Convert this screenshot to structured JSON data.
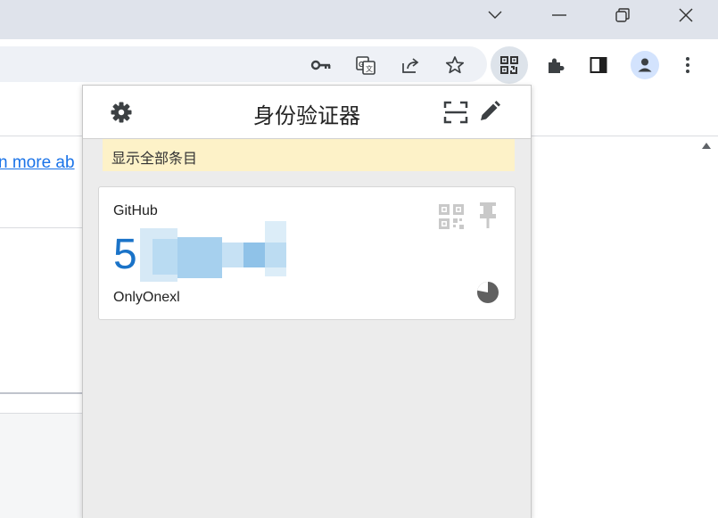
{
  "window": {
    "controls": [
      "chevron-down-icon",
      "minimize-icon",
      "restore-icon",
      "close-icon"
    ]
  },
  "toolbar": {
    "icons": [
      "key-icon",
      "translate-icon",
      "share-icon",
      "star-icon",
      "qr-extension-icon",
      "puzzle-icon",
      "side-panel-icon",
      "profile-icon",
      "more-vert-icon"
    ]
  },
  "page": {
    "link_text": "n more ab"
  },
  "popup": {
    "title": "身份验证器",
    "notice": "显示全部条目",
    "entry": {
      "issuer": "GitHub",
      "code_visible": "5",
      "account": "OnlyOnexl"
    }
  },
  "colors": {
    "titlebar": "#dfe3eb",
    "code": "#1a73c8",
    "notice_bg": "#fdf2c8",
    "link": "#1a73e8"
  }
}
